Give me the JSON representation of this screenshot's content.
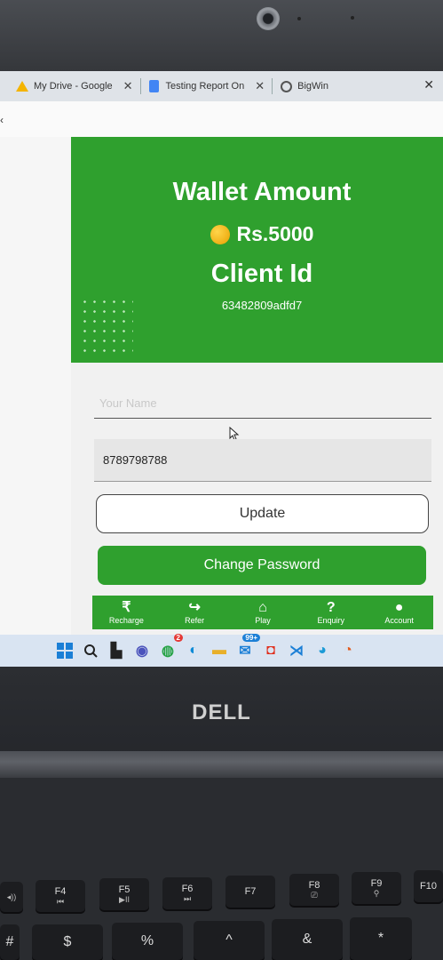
{
  "browser": {
    "tabs": [
      {
        "label": "My Drive - Google",
        "close": "✕"
      },
      {
        "label": "Testing Report On",
        "close": "✕"
      },
      {
        "label": "BigWin"
      }
    ],
    "window_close": "✕"
  },
  "wallet": {
    "title": "Wallet Amount",
    "amount": "Rs.5000",
    "client_label": "Client Id",
    "client_id": "63482809adfd7"
  },
  "form": {
    "name_placeholder": "Your Name",
    "phone_value": "8789798788",
    "update_label": "Update",
    "change_password_label": "Change Password"
  },
  "bottom_nav": [
    {
      "label": "Recharge",
      "glyph": "₹"
    },
    {
      "label": "Refer",
      "glyph": "↪"
    },
    {
      "label": "Play",
      "glyph": "⌂"
    },
    {
      "label": "Enquiry",
      "glyph": "?"
    },
    {
      "label": "Account",
      "glyph": "●"
    }
  ],
  "taskbar": {
    "whatsapp_badge": "2",
    "mail_badge": "99+"
  },
  "laptop": {
    "brand": "DELL",
    "keys_fn": [
      "F4",
      "F5",
      "F6",
      "F7",
      "F8",
      "F9",
      "F10"
    ],
    "keys_row2": [
      "#",
      "$",
      "%",
      "^",
      "&",
      "*"
    ]
  }
}
